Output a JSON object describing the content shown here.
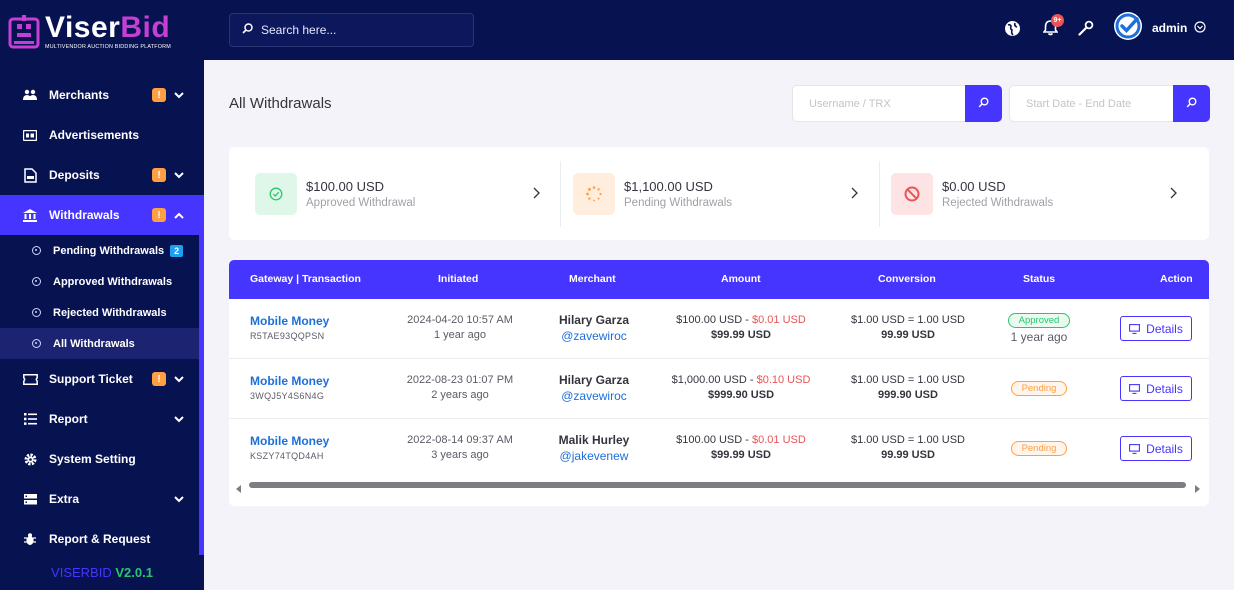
{
  "brand": {
    "name_part1": "Viser",
    "name_part2": "Bid",
    "tagline": "MULTIVENDOR AUCTION BIDDING PLATFORM",
    "version_name": "VISERBID",
    "version_number": "V2.0.1"
  },
  "colors": {
    "sidebar_bg": "#071251",
    "accent": "#4634ff",
    "brand_pink": "#c63fd5",
    "warning": "#ff9f43",
    "success": "#28c76f",
    "danger": "#ea5455",
    "link": "#1e6fd9"
  },
  "topbar": {
    "search_placeholder": "Search here...",
    "notification_count": "9+",
    "user_name": "admin",
    "icons": [
      "globe-icon",
      "bell-icon",
      "wrench-icon",
      "avatar",
      "chevron-down-circle-icon"
    ]
  },
  "sidebar": {
    "items": [
      {
        "label": "Merchants",
        "icon": "users-icon",
        "badge": "!",
        "chevron": "down"
      },
      {
        "label": "Advertisements",
        "icon": "ad-icon"
      },
      {
        "label": "Deposits",
        "icon": "file-invoice-icon",
        "badge": "!",
        "chevron": "down"
      },
      {
        "label": "Withdrawals",
        "icon": "bank-icon",
        "badge": "!",
        "chevron": "up",
        "active": true
      },
      {
        "label": "Support Ticket",
        "icon": "ticket-icon",
        "badge": "!",
        "chevron": "down"
      },
      {
        "label": "Report",
        "icon": "list-icon",
        "chevron": "down"
      },
      {
        "label": "System Setting",
        "icon": "cog-icon"
      },
      {
        "label": "Extra",
        "icon": "server-icon",
        "chevron": "down"
      },
      {
        "label": "Report & Request",
        "icon": "bug-icon"
      }
    ],
    "withdrawal_submenu": [
      {
        "label": "Pending Withdrawals",
        "badge": "2"
      },
      {
        "label": "Approved Withdrawals"
      },
      {
        "label": "Rejected Withdrawals"
      },
      {
        "label": "All Withdrawals",
        "active": true
      }
    ]
  },
  "page": {
    "title": "All Withdrawals",
    "search_placeholder": "Username / TRX",
    "date_placeholder": "Start Date - End Date"
  },
  "stats": [
    {
      "amount": "$100.00 USD",
      "label": "Approved Withdrawal",
      "icon": "check-circle-icon",
      "color": "#28c76f"
    },
    {
      "amount": "$1,100.00 USD",
      "label": "Pending Withdrawals",
      "icon": "spinner-icon",
      "color": "#ff9f43"
    },
    {
      "amount": "$0.00 USD",
      "label": "Rejected Withdrawals",
      "icon": "ban-icon",
      "color": "#ea5455"
    }
  ],
  "table": {
    "headers": [
      "Gateway | Transaction",
      "Initiated",
      "Merchant",
      "Amount",
      "Conversion",
      "Status",
      "Action"
    ],
    "rows": [
      {
        "gateway": "Mobile Money",
        "trx": "R5TAE93QQPSN",
        "date": "2024-04-20 10:57 AM",
        "ago": "1 year ago",
        "merchant": "Hilary Garza",
        "username": "@zavewiroc",
        "amount": "$100.00 USD",
        "charge": "$0.01 USD",
        "total": "$99.99 USD",
        "conversion": "$1.00 USD = 1.00 USD",
        "converted": "99.99 USD",
        "status": "Approved",
        "status_ago": "1 year ago",
        "action": "Details"
      },
      {
        "gateway": "Mobile Money",
        "trx": "3WQJ5Y4S6N4G",
        "date": "2022-08-23 01:07 PM",
        "ago": "2 years ago",
        "merchant": "Hilary Garza",
        "username": "@zavewiroc",
        "amount": "$1,000.00 USD",
        "charge": "$0.10 USD",
        "total": "$999.90 USD",
        "conversion": "$1.00 USD = 1.00 USD",
        "converted": "999.90 USD",
        "status": "Pending",
        "action": "Details"
      },
      {
        "gateway": "Mobile Money",
        "trx": "KSZY74TQD4AH",
        "date": "2022-08-14 09:37 AM",
        "ago": "3 years ago",
        "merchant": "Malik Hurley",
        "username": "@jakevenew",
        "amount": "$100.00 USD",
        "charge": "$0.01 USD",
        "total": "$99.99 USD",
        "conversion": "$1.00 USD = 1.00 USD",
        "converted": "99.99 USD",
        "status": "Pending",
        "action": "Details"
      }
    ]
  }
}
